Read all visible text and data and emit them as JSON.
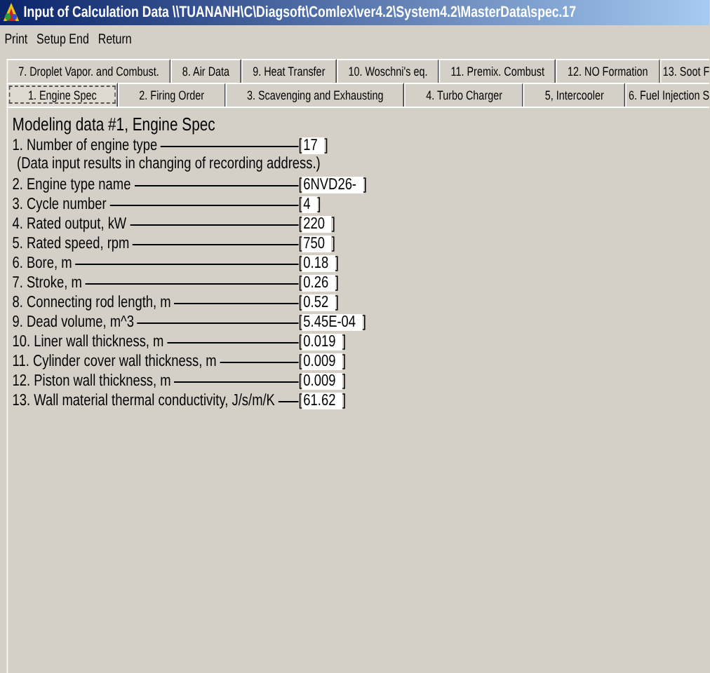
{
  "window": {
    "title": "Input of Calculation Data \\\\TUANANH\\C\\Diagsoft\\Comlex\\ver4.2\\System4.2\\MasterData\\spec.17"
  },
  "menu": [
    "Print",
    "Setup End",
    "Return"
  ],
  "tab_rows": [
    [
      {
        "label": "7. Droplet Vapor. and Combust.",
        "selected": false
      },
      {
        "label": "8. Air Data",
        "selected": false
      },
      {
        "label": "9. Heat Transfer",
        "selected": false
      },
      {
        "label": "10. Woschni's eq.",
        "selected": false
      },
      {
        "label": "11. Premix. Combust",
        "selected": false
      },
      {
        "label": "12. NO Formation",
        "selected": false
      },
      {
        "label": "13. Soot F",
        "selected": false
      }
    ],
    [
      {
        "label": "1. Engine Spec",
        "selected": true
      },
      {
        "label": "2. Firing Order",
        "selected": false
      },
      {
        "label": "3. Scavenging and Exhausting",
        "selected": false
      },
      {
        "label": "4. Turbo Charger",
        "selected": false
      },
      {
        "label": "5, Intercooler",
        "selected": false
      },
      {
        "label": "6. Fuel Injection S",
        "selected": false
      }
    ]
  ],
  "heading": "Modeling data #1, Engine Spec",
  "rows": [
    {
      "kind": "field",
      "label": "1. Number of engine type",
      "open": "[",
      "value": "17",
      "close": "]"
    },
    {
      "kind": "note",
      "label": "(Data input results in changing of recording address.)"
    },
    {
      "kind": "field",
      "label": "2. Engine type name",
      "open": "[",
      "value": "6NVD26-",
      "close": "]"
    },
    {
      "kind": "field",
      "label": "3. Cycle number",
      "open": "[",
      "value": "4",
      "close": "]"
    },
    {
      "kind": "field",
      "label": "4. Rated output, kW",
      "open": "[",
      "value": "220",
      "close": "]"
    },
    {
      "kind": "field",
      "label": "5. Rated speed, rpm",
      "open": "[",
      "value": "750",
      "close": "]"
    },
    {
      "kind": "field",
      "label": "6. Bore, m",
      "open": "[",
      "value": "0.18",
      "close": "]"
    },
    {
      "kind": "field",
      "label": "7. Stroke, m",
      "open": "[",
      "value": "0.26",
      "close": "]"
    },
    {
      "kind": "field",
      "label": "8. Connecting rod length, m",
      "open": "[",
      "value": "0.52",
      "close": "]"
    },
    {
      "kind": "field",
      "label": "9. Dead volume, m^3",
      "open": "[",
      "value": "5.45E-04",
      "close": "]"
    },
    {
      "kind": "field",
      "label": "10. Liner wall thickness, m",
      "open": "[",
      "value": "0.019",
      "close": "]"
    },
    {
      "kind": "field",
      "label": "11. Cylinder cover wall thickness, m",
      "open": "[",
      "value": "0.009",
      "close": "]"
    },
    {
      "kind": "field",
      "label": "12. Piston wall thickness, m",
      "open": "[",
      "value": "0.009",
      "close": "]"
    },
    {
      "kind": "field",
      "label": "13. Wall material thermal conductivity, J/s/m/K",
      "open": "[",
      "value": "61.62",
      "close": "]"
    }
  ]
}
